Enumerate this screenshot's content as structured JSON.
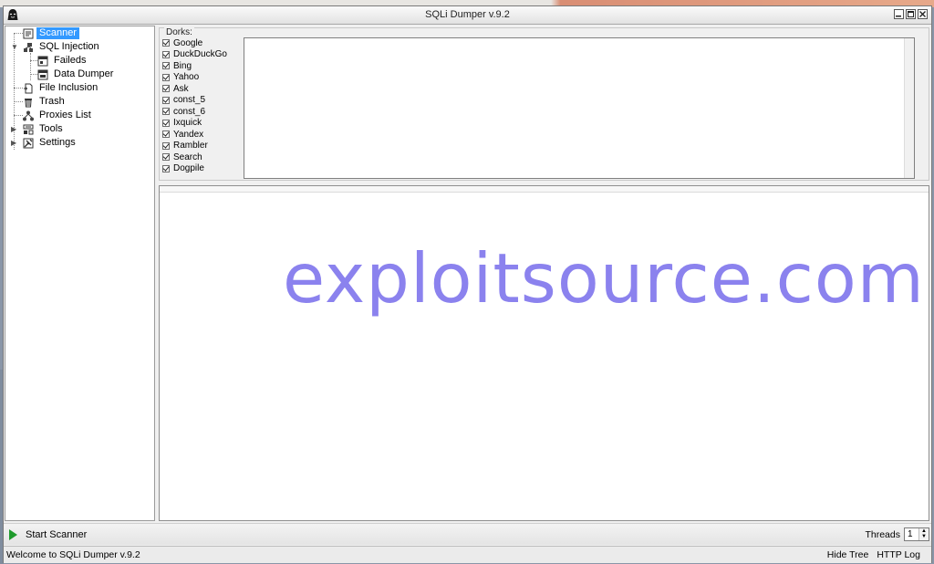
{
  "window": {
    "title": "SQLi Dumper v.9.2",
    "controls": {
      "minimize": "_",
      "maximize": "□",
      "close": "×"
    }
  },
  "tree": {
    "items": [
      {
        "label": "Scanner",
        "icon": "scanner-icon",
        "selected": true
      },
      {
        "label": "SQL Injection",
        "icon": "network-icon",
        "expanded": true
      },
      {
        "label": "Faileds",
        "icon": "window-icon"
      },
      {
        "label": "Data Dumper",
        "icon": "window-icon"
      },
      {
        "label": "File Inclusion",
        "icon": "file-icon"
      },
      {
        "label": "Trash",
        "icon": "trash-icon"
      },
      {
        "label": "Proxies List",
        "icon": "network-icon"
      },
      {
        "label": "Tools",
        "icon": "tools-icon"
      },
      {
        "label": "Settings",
        "icon": "settings-icon"
      }
    ]
  },
  "dorks": {
    "caption": "Dorks:",
    "engines": [
      "Google",
      "DuckDuckGo",
      "Bing",
      "Yahoo",
      "Ask",
      "const_5",
      "const_6",
      "Ixquick",
      "Yandex",
      "Rambler",
      "Search",
      "Dogpile"
    ]
  },
  "results": {
    "watermark": "exploitsource.com"
  },
  "toolbar": {
    "start_label": "Start Scanner",
    "threads_label": "Threads",
    "threads_value": "1"
  },
  "status": {
    "message": "Welcome to SQLi Dumper v.9.2",
    "hide_tree": "Hide Tree",
    "http_log": "HTTP Log"
  },
  "colors": {
    "selection": "#3399ff",
    "watermark": "#8b82ee",
    "play": "#1e9a2c"
  }
}
